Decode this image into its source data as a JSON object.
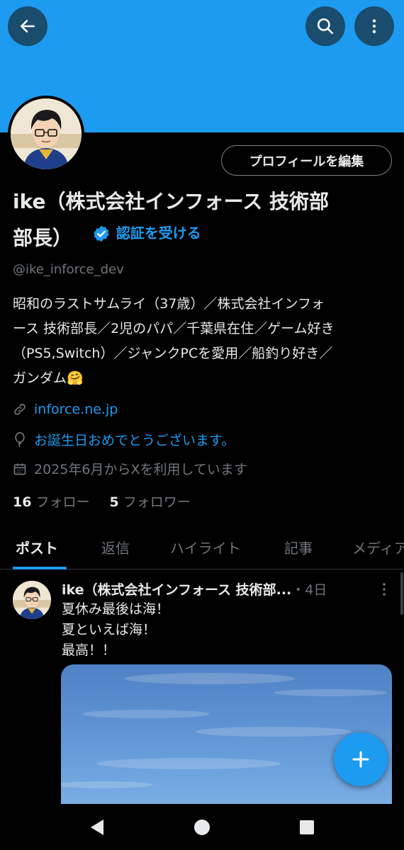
{
  "header": {
    "back_icon": "arrow-left-icon",
    "search_icon": "search-icon",
    "more_icon": "more-vertical-icon",
    "banner_color": "#1d9bf0"
  },
  "profile": {
    "edit_button_label": "プロフィールを編集",
    "name_line1": "ike（株式会社インフォース 技術部",
    "name_line2": "部長）",
    "verify_label": "認証を受ける",
    "handle": "@ike_inforce_dev",
    "bio_lines": [
      "昭和のラストサムライ（37歳）／株式会社インフォ",
      "ース 技術部長／2児のパパ／千葉県在住／ゲーム好き",
      "（PS5,Switch）／ジャンクPCを愛用／船釣り好き／",
      "ガンダム🤗"
    ],
    "website": "inforce.ne.jp",
    "birthday": "お誕生日おめでとうございます。",
    "joined": "2025年6月からXを利用しています",
    "following_count": "16",
    "following_label": "フォロー",
    "followers_count": "5",
    "followers_label": "フォロワー"
  },
  "tabs": [
    {
      "label": "ポスト",
      "active": true
    },
    {
      "label": "返信",
      "active": false
    },
    {
      "label": "ハイライト",
      "active": false
    },
    {
      "label": "記事",
      "active": false
    },
    {
      "label": "メディア",
      "active": false
    }
  ],
  "post": {
    "author": "ike（株式会社インフォース 技術部...",
    "time": "・4日",
    "lines": [
      "夏休み最後は海！",
      "夏といえば海！",
      "最高！！"
    ]
  },
  "accent_color": "#1d9bf0"
}
